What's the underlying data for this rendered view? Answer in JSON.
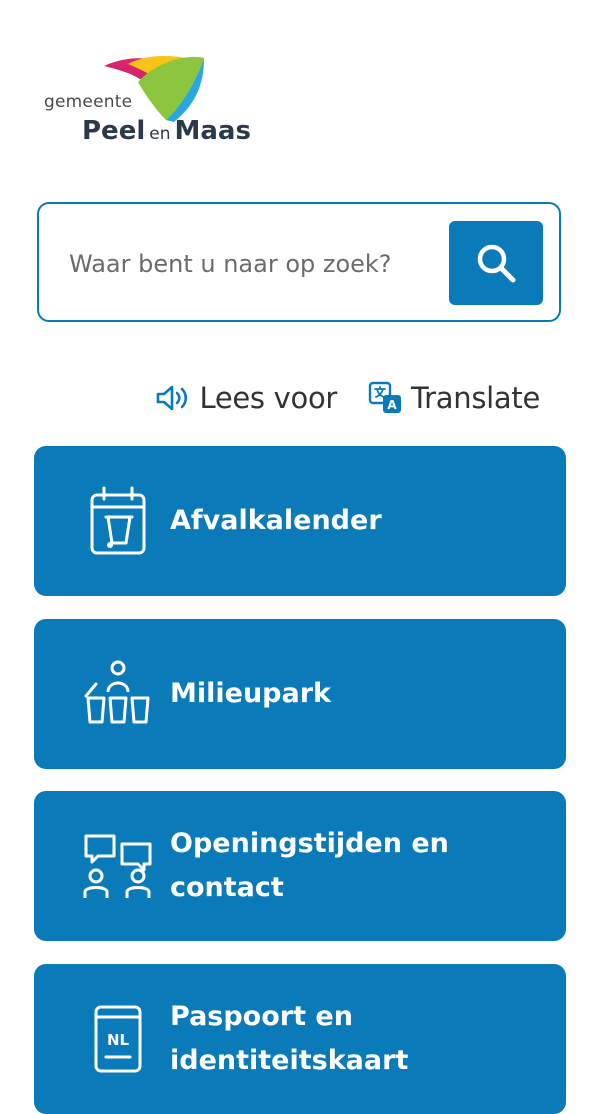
{
  "logo": {
    "small_text": "gemeente",
    "name_part1": "Peel",
    "name_connector": "en",
    "name_part2": "Maas",
    "colors": [
      "#d6246e",
      "#f6c316",
      "#8cc63f",
      "#2aa7df"
    ]
  },
  "search": {
    "placeholder": "Waar bent u naar op zoek?",
    "value": "",
    "button_icon": "search-icon"
  },
  "tools": {
    "read_aloud_label": "Lees voor",
    "read_aloud_icon": "speaker-icon",
    "translate_label": "Translate",
    "translate_icon": "translate-icon"
  },
  "tiles": [
    {
      "label": "Afvalkalender",
      "icon": "waste-calendar-icon"
    },
    {
      "label": "Milieupark",
      "icon": "recycling-park-icon"
    },
    {
      "label": "Openingstijden en contact",
      "icon": "contact-people-icon"
    },
    {
      "label": "Paspoort en identiteitskaart",
      "icon": "passport-icon"
    }
  ],
  "colors": {
    "primary": "#0a7ab8",
    "text": "#333333",
    "background": "#ffffff"
  }
}
